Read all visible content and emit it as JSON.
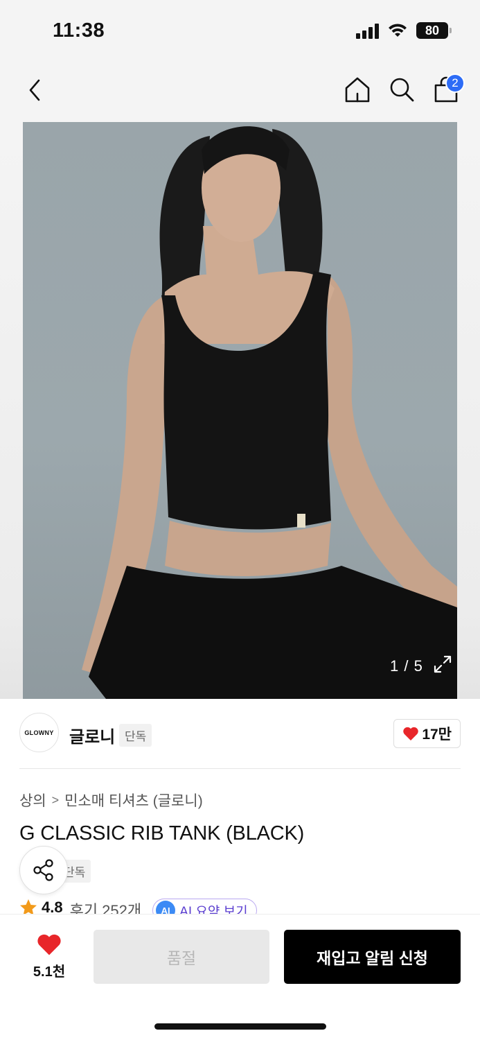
{
  "status_bar": {
    "time": "11:38",
    "battery": "80"
  },
  "nav": {
    "cart_count": "2"
  },
  "image": {
    "counter": "1 / 5"
  },
  "brand": {
    "logo_text": "GLOWNY",
    "name": "글로니",
    "tag": "단독",
    "likes": "17만"
  },
  "breadcrumb": {
    "category": "상의",
    "separator": ">",
    "subcategory": "민소매 티셔츠 (글로니)"
  },
  "product": {
    "title": "G CLASSIC RIB TANK (BLACK)",
    "tag": "단독"
  },
  "rating": {
    "value": "4.8",
    "reviews": "후기 252개",
    "ai_badge": "AI",
    "ai_label": "AI 요약 보기"
  },
  "bottom": {
    "wish_count": "5.1천",
    "soldout_label": "품절",
    "restock_label": "재입고 알림 신청"
  },
  "colors": {
    "accent_blue": "#2d6cf6",
    "heart_red": "#e8262a",
    "ai_purple": "#5b3fd0",
    "star": "#f29a1a"
  }
}
